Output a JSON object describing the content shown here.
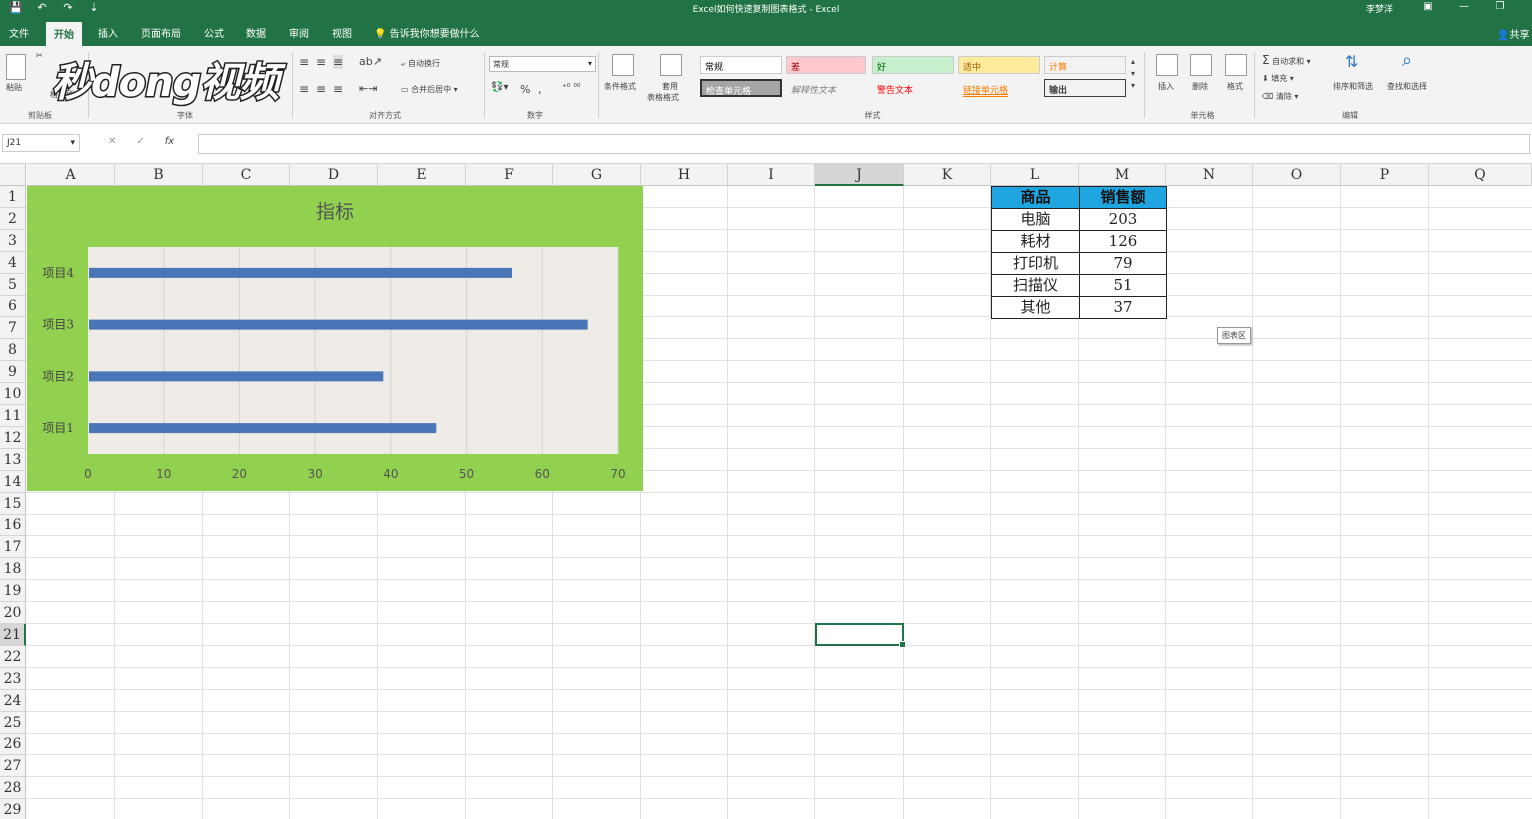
{
  "window": {
    "title": "Excel如何快速复制图表格式 - Excel",
    "user": "李梦洋",
    "qat": [
      "💾",
      "↶",
      "↷",
      "⇣"
    ]
  },
  "tabs": [
    "文件",
    "开始",
    "插入",
    "页面布局",
    "公式",
    "数据",
    "审阅",
    "视图",
    "告诉我你想要做什么"
  ],
  "share": "共享",
  "watermark": "秒dong视频",
  "ribbon": {
    "groups": [
      "剪贴板",
      "字体",
      "对齐方式",
      "数字",
      "样式",
      "单元格",
      "编辑"
    ],
    "paste": "粘贴",
    "format_painter": "格式刷",
    "wrap_text": "自动换行",
    "merge_center": "合并后居中",
    "number_format": "常规",
    "cond_format": "条件格式",
    "table_format_1": "套用",
    "table_format_2": "表格格式",
    "styles": [
      {
        "label": "常规",
        "bg": "#ffffff",
        "color": "#000000"
      },
      {
        "label": "差",
        "bg": "#ffc7ce",
        "color": "#9c0006"
      },
      {
        "label": "好",
        "bg": "#c6efce",
        "color": "#006100"
      },
      {
        "label": "适中",
        "bg": "#ffeb9c",
        "color": "#9c5700"
      },
      {
        "label": "计算",
        "bg": "#f2f2f2",
        "color": "#fa7d00"
      },
      {
        "label": "检查单元格",
        "bg": "#a5a5a5",
        "color": "#ffffff"
      },
      {
        "label": "解释性文本",
        "bg": "#f3f3f3",
        "color": "#7f7f7f"
      },
      {
        "label": "警告文本",
        "bg": "#f3f3f3",
        "color": "#ff0000"
      },
      {
        "label": "链接单元格",
        "bg": "#f3f3f3",
        "color": "#fa7d00"
      },
      {
        "label": "输出",
        "bg": "#f2f2f2",
        "color": "#3f3f3f"
      }
    ],
    "insert": "插入",
    "delete": "删除",
    "format": "格式",
    "autosum": "自动求和",
    "fill": "填充",
    "clear": "清除",
    "sort_filter": "排序和筛选",
    "find_select": "查找和选择"
  },
  "formula_bar": {
    "name_box": "J21",
    "cancel": "✕",
    "enter": "✓",
    "fx": "fx",
    "value": ""
  },
  "columns": [
    "A",
    "B",
    "C",
    "D",
    "E",
    "F",
    "G",
    "H",
    "I",
    "J",
    "K",
    "L",
    "M",
    "N",
    "O",
    "P",
    "Q"
  ],
  "rows": [
    "1",
    "2",
    "3",
    "4",
    "5",
    "6",
    "7",
    "8",
    "9",
    "10",
    "11",
    "12",
    "13",
    "14",
    "15",
    "16",
    "17",
    "18",
    "19",
    "20",
    "21",
    "22",
    "23",
    "24",
    "25",
    "26",
    "27",
    "28",
    "29"
  ],
  "selected": {
    "column": "J",
    "row": "21"
  },
  "table": {
    "headers": [
      "商品",
      "销售额"
    ],
    "rows": [
      [
        "电脑",
        "203"
      ],
      [
        "耗材",
        "126"
      ],
      [
        "打印机",
        "79"
      ],
      [
        "扫描仪",
        "51"
      ],
      [
        "其他",
        "37"
      ]
    ],
    "header_bg": "#1fa6e0"
  },
  "tooltip": "图表区",
  "chart_data": {
    "type": "bar",
    "orientation": "horizontal",
    "title": "指标",
    "categories": [
      "项目1",
      "项目2",
      "项目3",
      "项目4"
    ],
    "values": [
      46,
      39,
      66,
      56
    ],
    "xlim": [
      0,
      70
    ],
    "xticks": [
      "0",
      "10",
      "20",
      "30",
      "40",
      "50",
      "60",
      "70"
    ],
    "grid": true,
    "bar_color": "#4a76b8",
    "chart_bg": "#92d050",
    "plot_bg": "#efebe6"
  }
}
